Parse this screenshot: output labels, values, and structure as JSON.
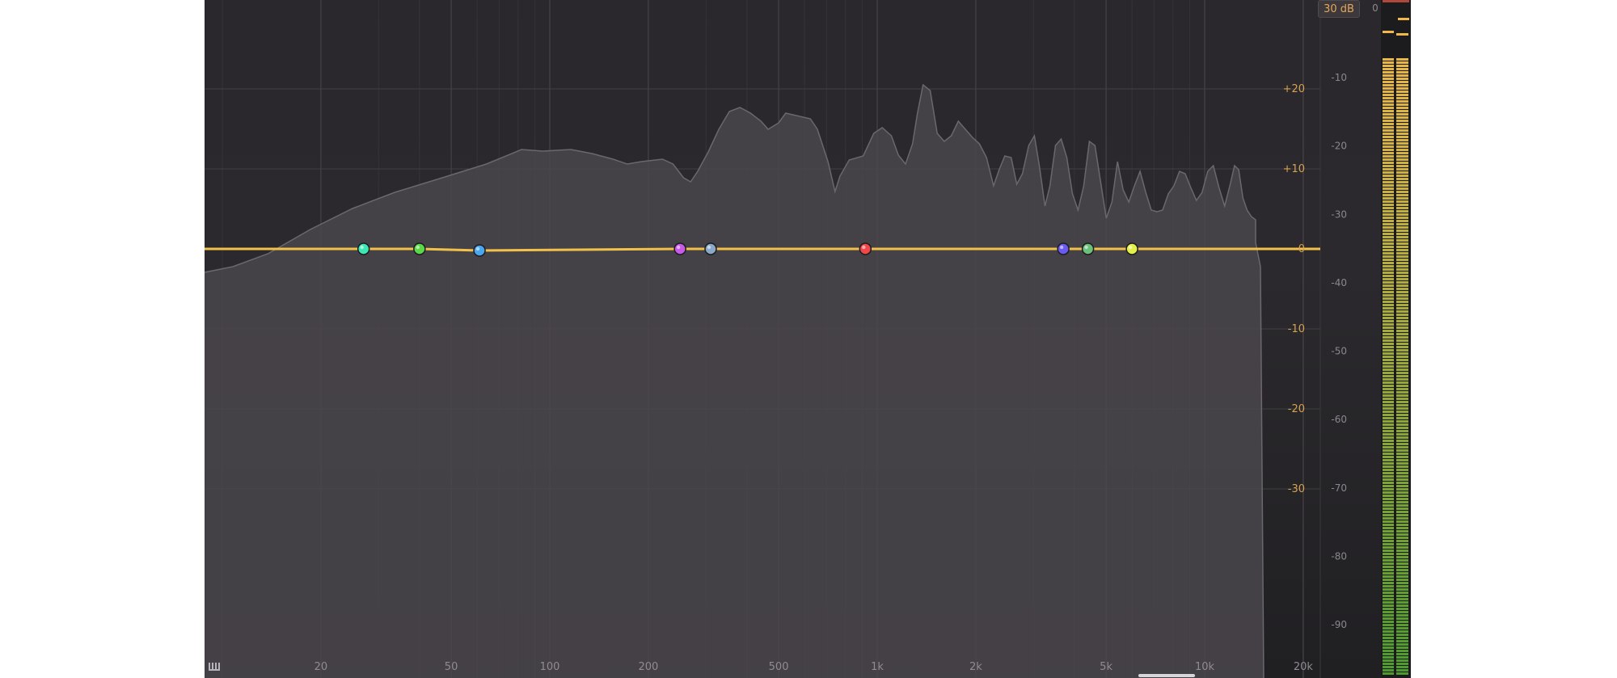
{
  "range": {
    "label": "30 dB"
  },
  "frequency_axis": {
    "ticks": [
      {
        "freq": 20,
        "label": "20"
      },
      {
        "freq": 50,
        "label": "50"
      },
      {
        "freq": 100,
        "label": "100"
      },
      {
        "freq": 200,
        "label": "200"
      },
      {
        "freq": 500,
        "label": "500"
      },
      {
        "freq": 1000,
        "label": "1k"
      },
      {
        "freq": 2000,
        "label": "2k"
      },
      {
        "freq": 5000,
        "label": "5k"
      },
      {
        "freq": 10000,
        "label": "10k"
      },
      {
        "freq": 20000,
        "label": "20k"
      }
    ]
  },
  "gain_axis": {
    "ticks": [
      {
        "db": 20,
        "label": "+20"
      },
      {
        "db": 10,
        "label": "+10"
      },
      {
        "db": 0,
        "label": "0"
      },
      {
        "db": -10,
        "label": "-10"
      },
      {
        "db": -20,
        "label": "-20"
      },
      {
        "db": -30,
        "label": "-30"
      }
    ]
  },
  "meter_scale": {
    "top_label": "0",
    "ticks": [
      {
        "db": -10,
        "label": "-10"
      },
      {
        "db": -20,
        "label": "-20"
      },
      {
        "db": -30,
        "label": "-30"
      },
      {
        "db": -40,
        "label": "-40"
      },
      {
        "db": -50,
        "label": "-50"
      },
      {
        "db": -60,
        "label": "-60"
      },
      {
        "db": -70,
        "label": "-70"
      },
      {
        "db": -80,
        "label": "-80"
      },
      {
        "db": -90,
        "label": "-90"
      }
    ]
  },
  "bands": [
    {
      "freq": 27,
      "gain": 0.0,
      "color": "#3ee8b5"
    },
    {
      "freq": 40,
      "gain": 0.0,
      "color": "#5bd84a"
    },
    {
      "freq": 61,
      "gain": -0.2,
      "color": "#4aa6ee"
    },
    {
      "freq": 250,
      "gain": 0.0,
      "color": "#c85ae8"
    },
    {
      "freq": 310,
      "gain": 0.0,
      "color": "#8aa8c8"
    },
    {
      "freq": 920,
      "gain": 0.0,
      "color": "#f04848"
    },
    {
      "freq": 3700,
      "gain": 0.0,
      "color": "#6a5af0"
    },
    {
      "freq": 4400,
      "gain": 0.0,
      "color": "#6abf7a"
    },
    {
      "freq": 6000,
      "gain": 0.0,
      "color": "#e4f04a"
    }
  ],
  "colors": {
    "eq_curve": "#f2c14a",
    "spectrum_fill": "#4a474c",
    "spectrum_line": "#6a676d",
    "meter_peak": "#f0b848",
    "meter_low": "#4e9a2e"
  },
  "meter": {
    "level_fraction": 0.955
  }
}
